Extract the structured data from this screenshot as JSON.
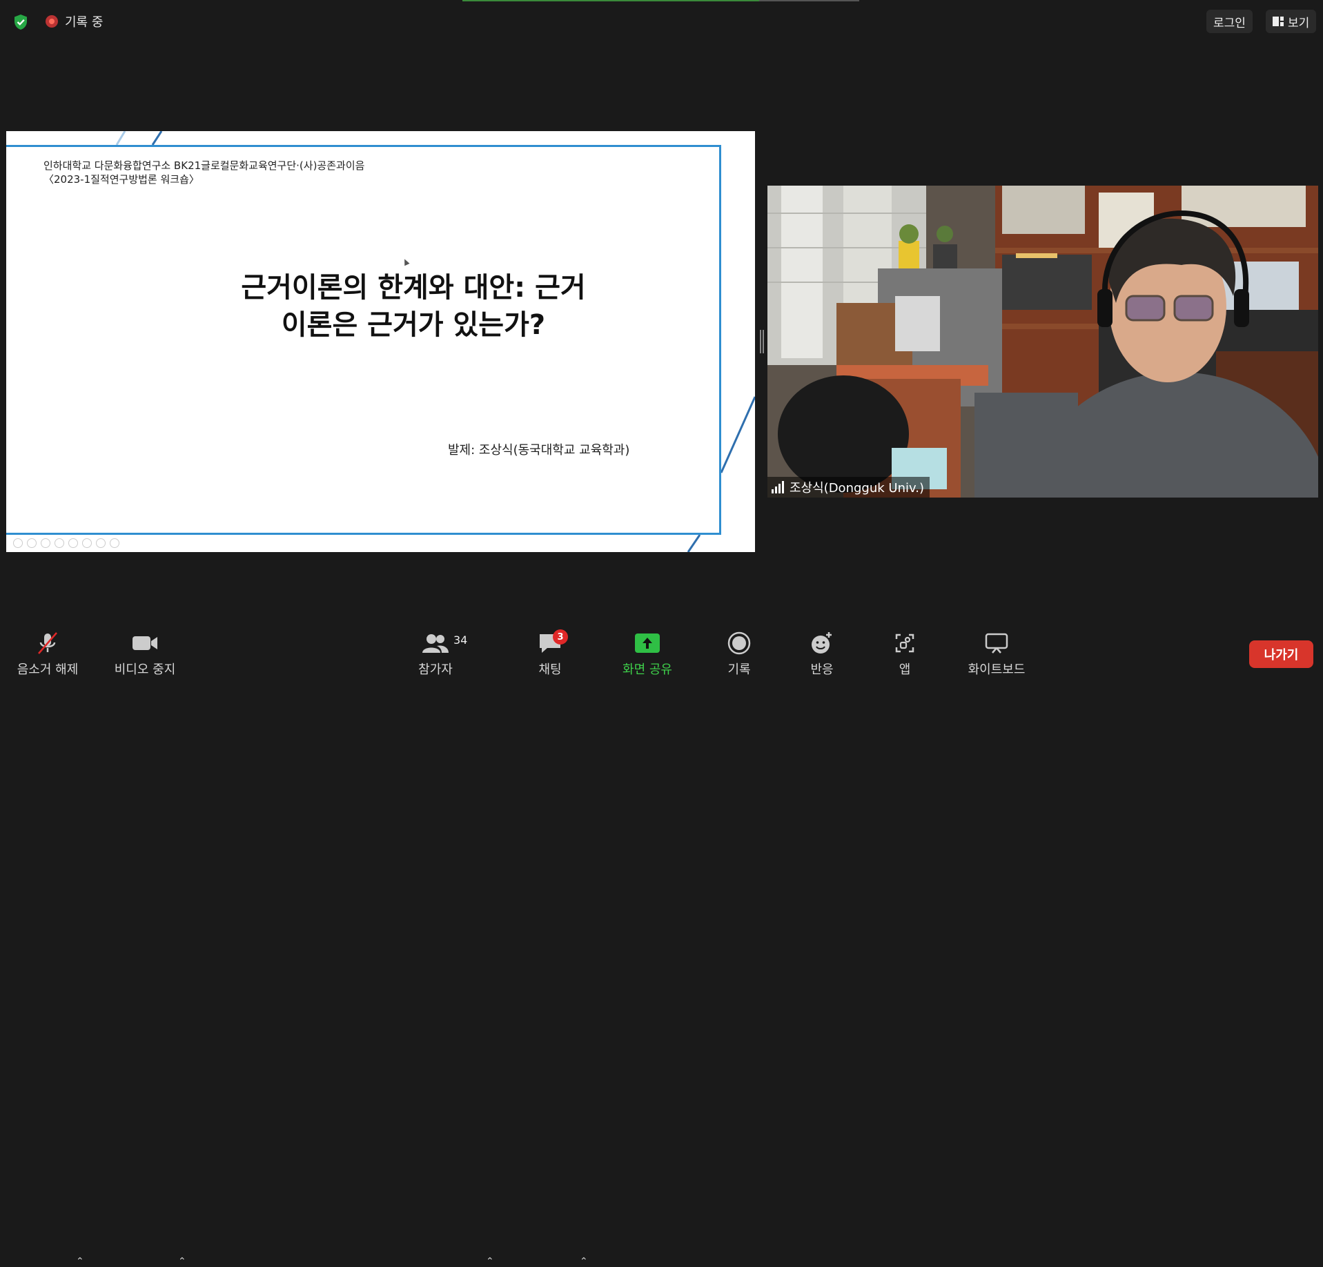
{
  "topbar": {
    "recording_label": "기록 중",
    "login_label": "로그인",
    "view_label": "보기"
  },
  "slide": {
    "header_line1": "인하대학교 다문화융합연구소 BK21글로컬문화교육연구단·(사)공존과이음",
    "header_line2": "〈2023-1질적연구방법론 워크숍〉",
    "title_line1": "근거이론의 한계와 대안: 근거",
    "title_line2": "이론은 근거가 있는가?",
    "presenter": "발제: 조상식(동국대학교 교육학과)"
  },
  "video": {
    "participant_name": "조상식(Dongguk Univ.)"
  },
  "toolbar": {
    "mute_label": "음소거 해제",
    "video_label": "비디오 중지",
    "participants_label": "참가자",
    "participants_count": "34",
    "chat_label": "채팅",
    "chat_badge": "3",
    "share_label": "화면 공유",
    "record_label": "기록",
    "reactions_label": "반응",
    "apps_label": "앱",
    "whiteboard_label": "화이트보드",
    "leave_label": "나가기"
  },
  "colors": {
    "background": "#1a1a1a",
    "accent_green": "#3ecf4a",
    "leave_red": "#d8352b",
    "badge_red": "#e02828",
    "slide_border": "#2f8ed0"
  }
}
